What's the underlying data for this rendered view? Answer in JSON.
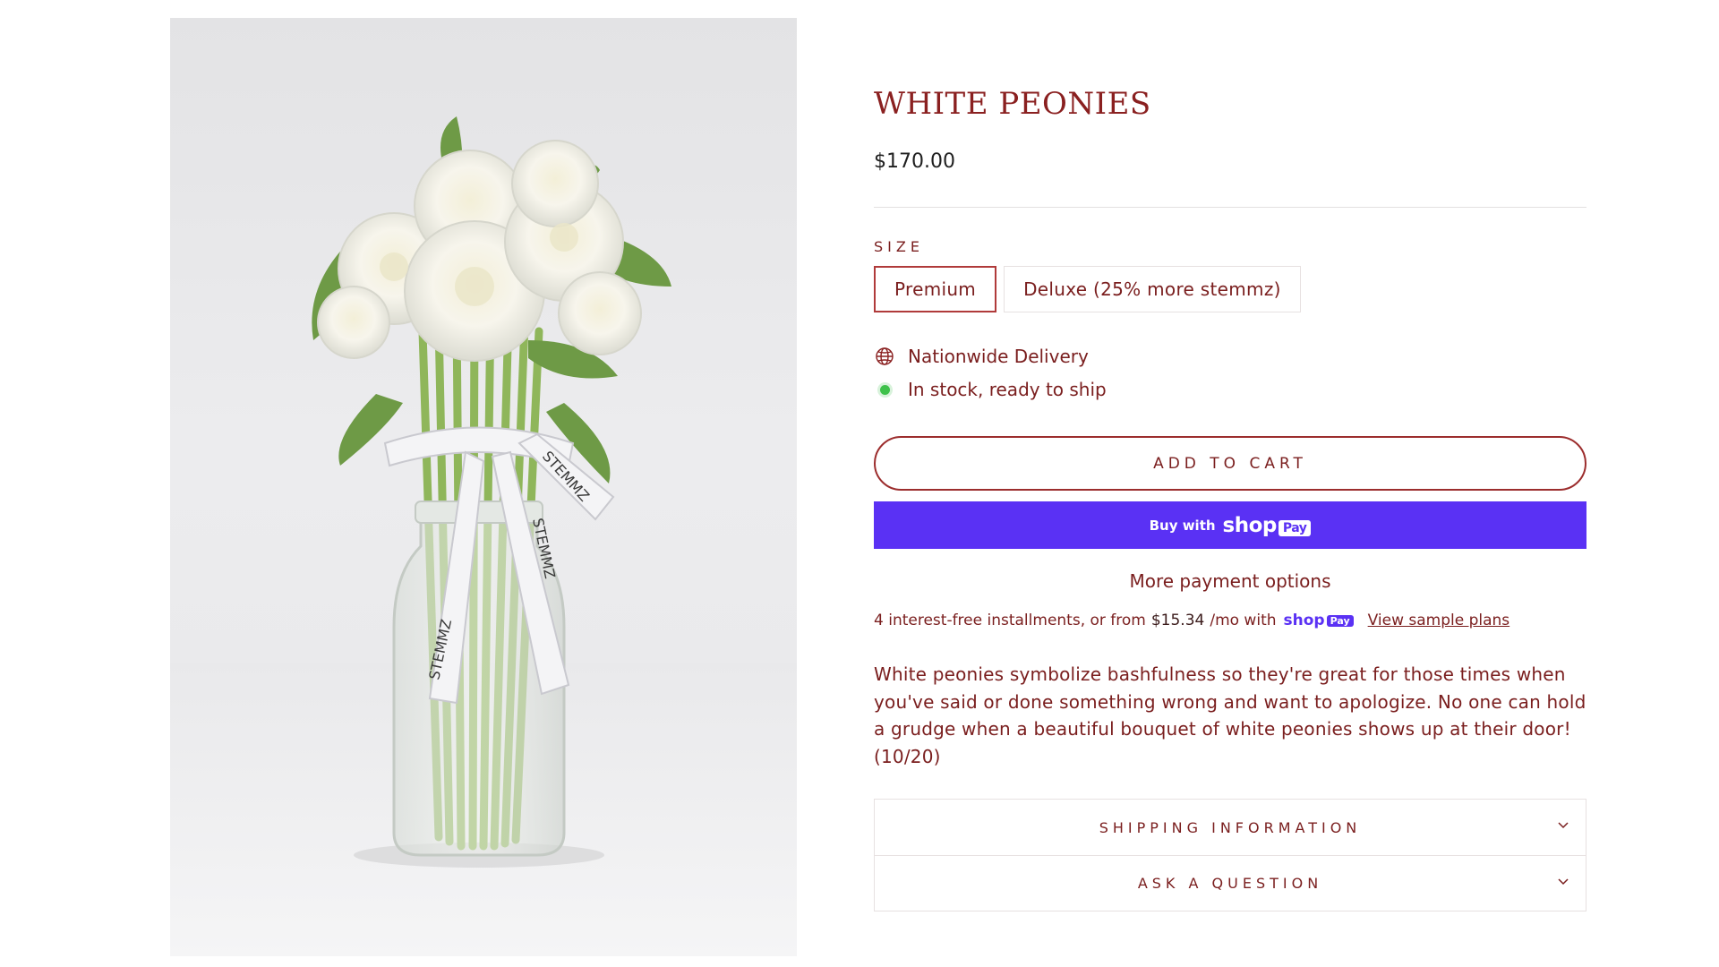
{
  "product": {
    "title": "WHITE PEONIES",
    "price": "$170.00",
    "image_alt": "White peonies bouquet in glass jar with STEMMZ ribbon",
    "ribbon_text": "STEMMZ"
  },
  "size": {
    "label": "SIZE",
    "options": [
      {
        "label": "Premium",
        "selected": true
      },
      {
        "label": "Deluxe (25% more stemmz)",
        "selected": false
      }
    ]
  },
  "info_lines": {
    "delivery": "Nationwide Delivery",
    "delivery_icon": "globe-icon",
    "stock": "In stock, ready to ship",
    "stock_icon": "green-dot-icon"
  },
  "buttons": {
    "add_to_cart": "ADD TO CART",
    "buy_with": "Buy with",
    "shop_wordmark": "shop",
    "pay_badge": "Pay",
    "more_payment": "More payment options"
  },
  "installments": {
    "prefix": "4 interest-free installments, or from",
    "amount": "$15.34",
    "suffix": "/mo with",
    "shop_word": "shop",
    "pay_word": "Pay",
    "link": "View sample plans"
  },
  "description": "White peonies symbolize bashfulness so they're great for those times when you've said or done something wrong and want to apologize. No one can hold a grudge when a beautiful bouquet of white peonies shows up at their door!  (10/20)",
  "accordion": {
    "shipping": "SHIPPING INFORMATION",
    "question": "ASK A QUESTION"
  },
  "colors": {
    "brand_text": "#7a1e1e",
    "title": "#8a2020",
    "shop_pay": "#5a31f4",
    "in_stock": "#3ec14a"
  }
}
